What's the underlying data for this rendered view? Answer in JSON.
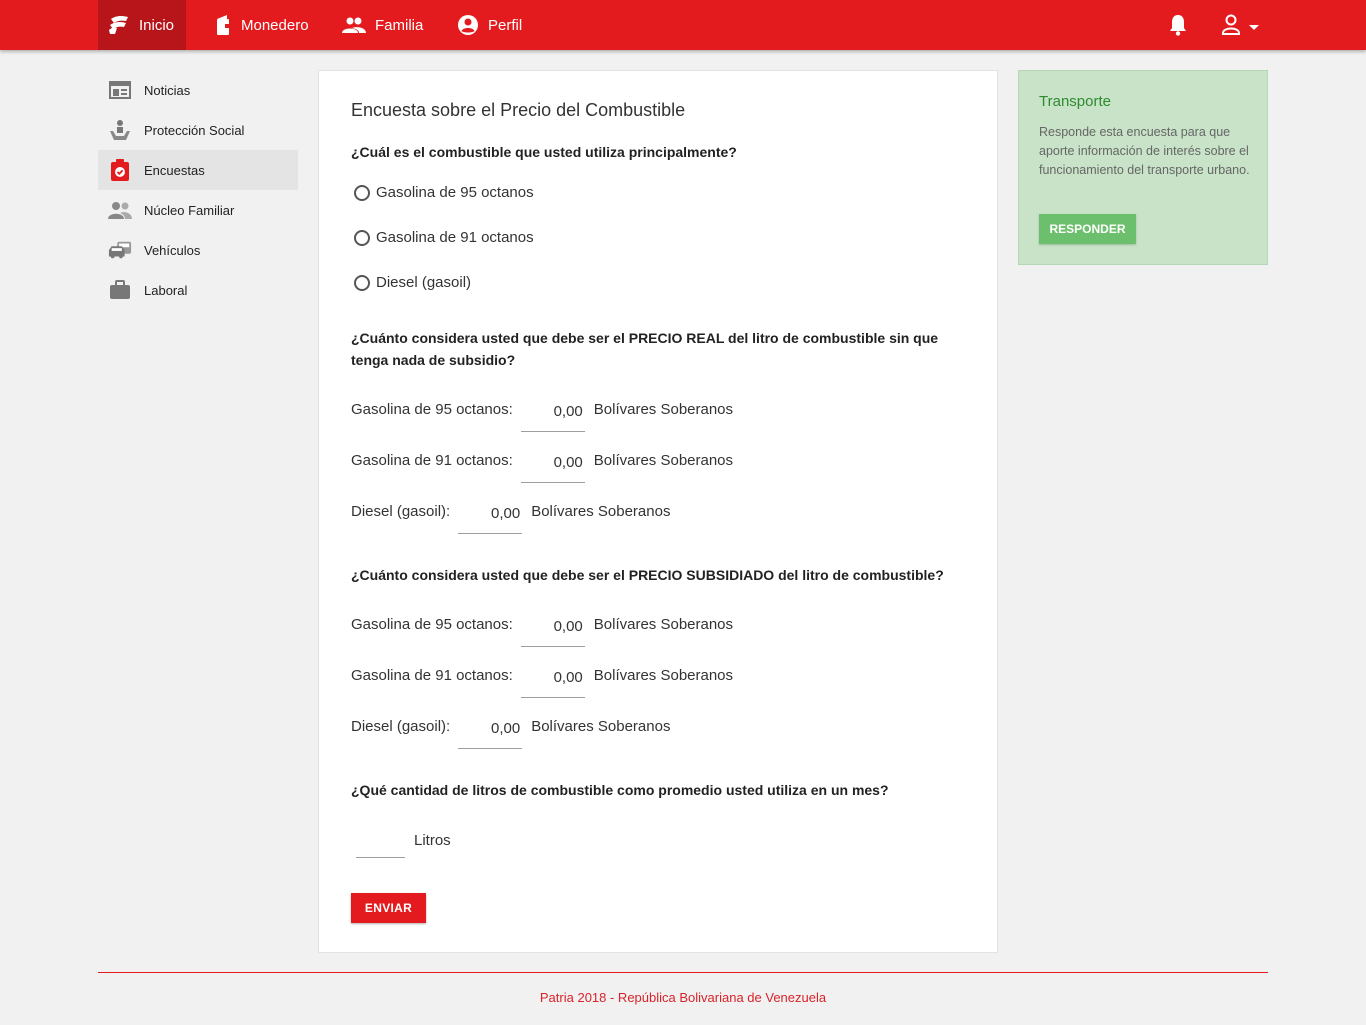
{
  "nav": {
    "items": [
      {
        "label": "Inicio",
        "icon": "patria-logo-icon"
      },
      {
        "label": "Monedero",
        "icon": "wallet-icon"
      },
      {
        "label": "Familia",
        "icon": "people-icon"
      },
      {
        "label": "Perfil",
        "icon": "account-circle-icon"
      }
    ],
    "bell_icon": "bell-icon",
    "user_icon": "user-icon"
  },
  "sidebar": {
    "items": [
      {
        "label": "Noticias",
        "icon": "news-icon"
      },
      {
        "label": "Protección Social",
        "icon": "social-protection-icon"
      },
      {
        "label": "Encuestas",
        "icon": "survey-icon"
      },
      {
        "label": "Núcleo Familiar",
        "icon": "family-icon"
      },
      {
        "label": "Vehículos",
        "icon": "vehicles-icon"
      },
      {
        "label": "Laboral",
        "icon": "briefcase-icon"
      }
    ]
  },
  "survey": {
    "title": "Encuesta sobre el Precio del Combustible",
    "q1": {
      "text": "¿Cuál es el combustible que usted utiliza principalmente?",
      "options": [
        "Gasolina de 95 octanos",
        "Gasolina de 91 octanos",
        "Diesel (gasoil)"
      ]
    },
    "q2": {
      "text": "¿Cuánto considera usted que debe ser el PRECIO REAL del litro de combustible sin que tenga nada de subsidio?",
      "rows": [
        {
          "label": "Gasolina de 95 octanos:",
          "value": "0,00",
          "unit": "Bolívares Soberanos"
        },
        {
          "label": "Gasolina de 91 octanos:",
          "value": "0,00",
          "unit": "Bolívares Soberanos"
        },
        {
          "label": "Diesel (gasoil):",
          "value": "0,00",
          "unit": "Bolívares Soberanos"
        }
      ]
    },
    "q3": {
      "text": "¿Cuánto considera usted que debe ser el PRECIO SUBSIDIADO del litro de combustible?",
      "rows": [
        {
          "label": "Gasolina de 95 octanos:",
          "value": "0,00",
          "unit": "Bolívares Soberanos"
        },
        {
          "label": "Gasolina de 91 octanos:",
          "value": "0,00",
          "unit": "Bolívares Soberanos"
        },
        {
          "label": "Diesel (gasoil):",
          "value": "0,00",
          "unit": "Bolívares Soberanos"
        }
      ]
    },
    "q4": {
      "text": "¿Qué cantidad de litros de combustible como promedio usted utiliza en un mes?",
      "unit": "Litros",
      "value": ""
    },
    "submit_label": "ENVIAR"
  },
  "promo": {
    "title": "Transporte",
    "text": "Responde esta encuesta para que aporte información de interés sobre el funcionamiento del transporte urbano.",
    "button_label": "RESPONDER"
  },
  "footer": {
    "text": "Patria 2018 - República Bolivariana de Venezuela"
  },
  "colors": {
    "brand_red": "#e31b1e",
    "active_nav": "#b8151a",
    "promo_bg": "#c8e3c8",
    "promo_title": "#2e8b2e",
    "promo_button": "#6cbf6c"
  }
}
